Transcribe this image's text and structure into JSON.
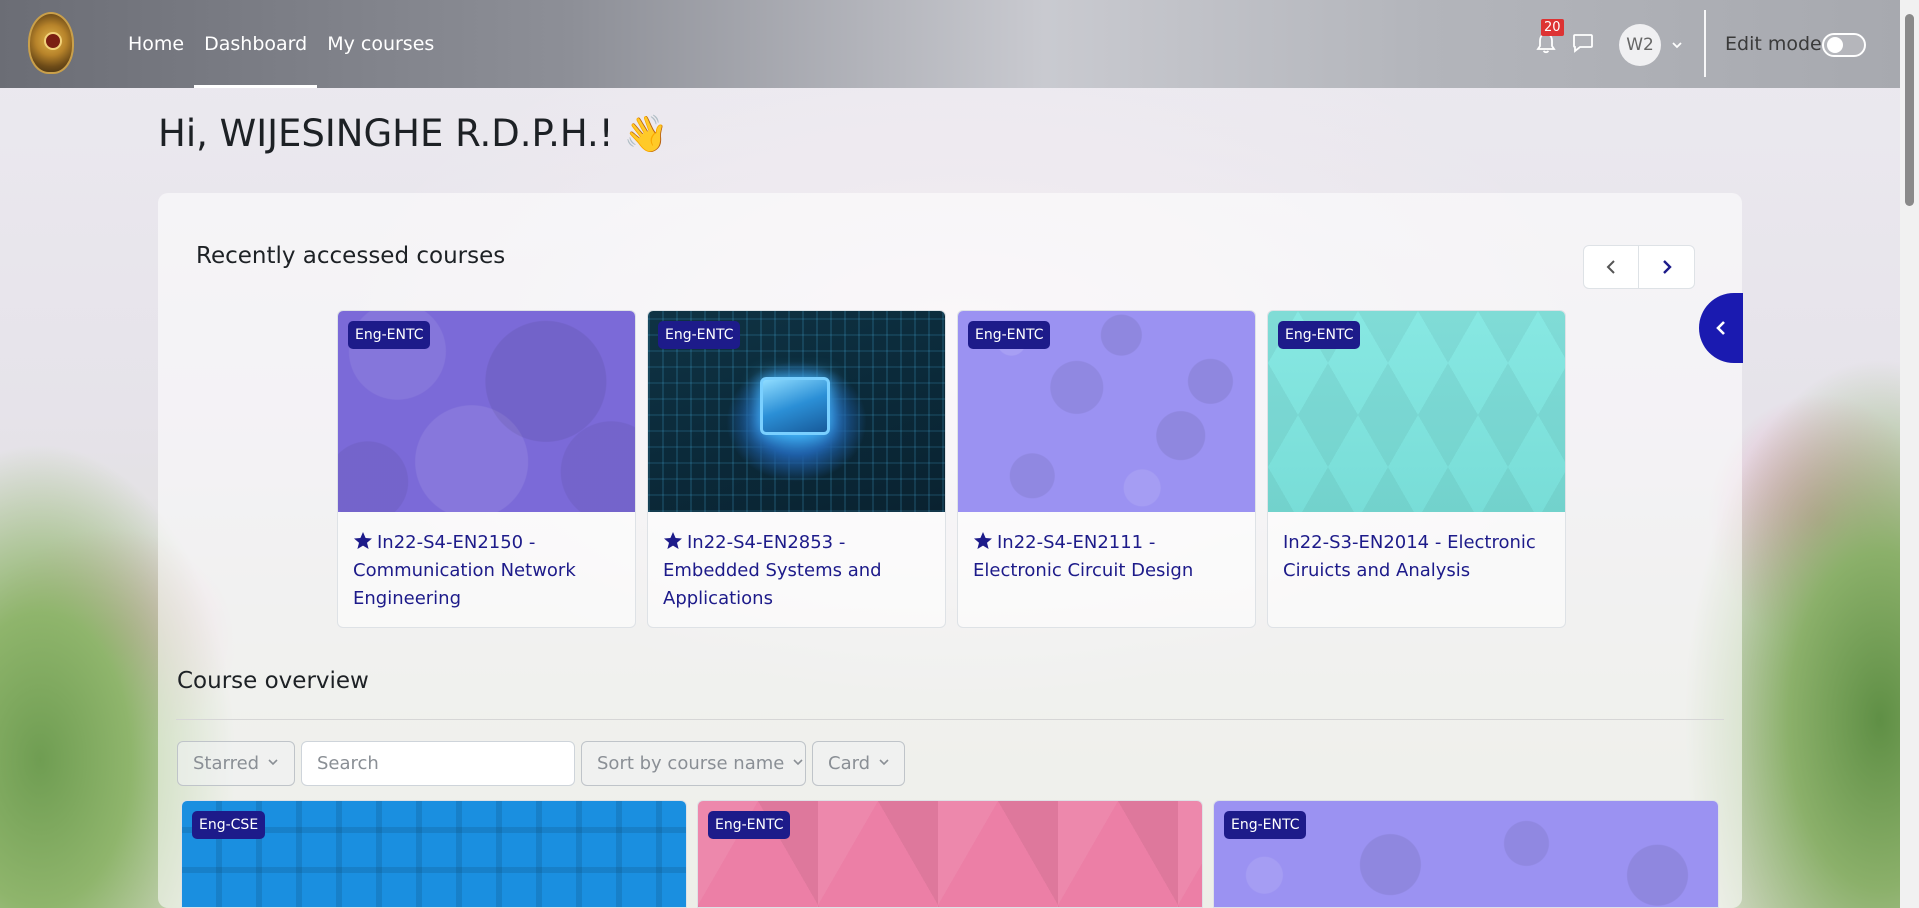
{
  "nav": {
    "links": [
      "Home",
      "Dashboard",
      "My courses"
    ],
    "active": "Dashboard",
    "notification_count": "20",
    "avatar_initials": "W2",
    "edit_mode_label": "Edit mode",
    "edit_mode_on": false
  },
  "greeting": {
    "text": "Hi, WIJESINGHE R.D.P.H.!",
    "emoji": "👋"
  },
  "recent": {
    "title": "Recently accessed courses",
    "courses": [
      {
        "category": "Eng-ENTC",
        "title": "In22-S4-EN2150 - Communication Network Engineering",
        "starred": true,
        "image": "purple-circles"
      },
      {
        "category": "Eng-ENTC",
        "title": "In22-S4-EN2853 - Embedded Systems and Applications",
        "starred": true,
        "image": "circuit-chip-photo"
      },
      {
        "category": "Eng-ENTC",
        "title": "In22-S4-EN2111 - Electronic Circuit Design",
        "starred": true,
        "image": "lilac-rings"
      },
      {
        "category": "Eng-ENTC",
        "title": "In22-S3-EN2014 - Electronic Ciruicts and Analysis",
        "starred": false,
        "image": "teal-triangles"
      }
    ]
  },
  "overview": {
    "title": "Course overview",
    "filter_label": "Starred",
    "search_placeholder": "Search",
    "sort_label": "Sort by course name",
    "view_label": "Card",
    "cards": [
      {
        "category": "Eng-CSE",
        "image": "blue-squares"
      },
      {
        "category": "Eng-ENTC",
        "image": "pink-triangles"
      },
      {
        "category": "Eng-ENTC",
        "image": "lilac-rings"
      }
    ]
  },
  "colors": {
    "accent": "#1d1b8a",
    "link": "#1d1b8a",
    "drawer_button": "#1a1ab0",
    "notification_badge": "#dd3333"
  }
}
